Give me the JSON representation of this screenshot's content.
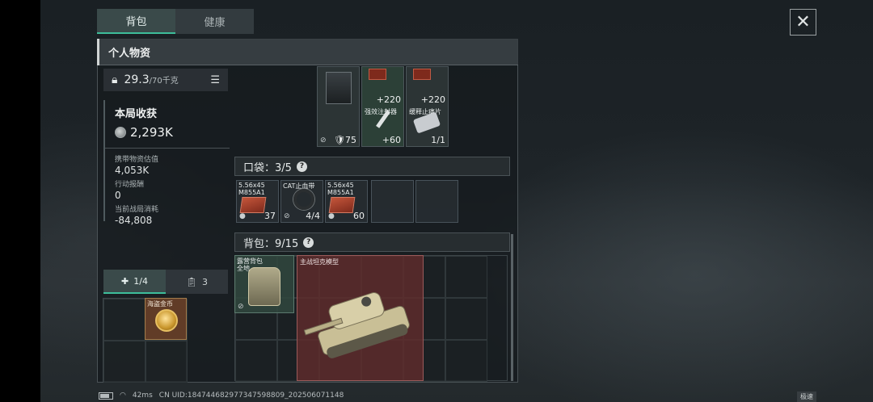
{
  "tabs": [
    {
      "label": "背包",
      "active": true
    },
    {
      "label": "健康",
      "active": false
    }
  ],
  "panel": {
    "title": "个人物资"
  },
  "weight": {
    "value": "29.3",
    "max": "/70千克"
  },
  "harvest": {
    "title": "本局收获",
    "total": "2,293K",
    "stats": [
      {
        "label": "携带物资估值",
        "value": "4,053K"
      },
      {
        "label": "行动报酬",
        "value": "0"
      },
      {
        "label": "当前战局消耗",
        "value": "-84,808"
      }
    ]
  },
  "side_tabs": [
    {
      "label": "1/4",
      "icon": "medkit-icon",
      "active": true
    },
    {
      "label": "3",
      "icon": "clipboard-icon",
      "active": false
    }
  ],
  "safe_box": {
    "item_label": "海盗金币"
  },
  "top_items": [
    {
      "name": "",
      "value": "75"
    },
    {
      "name": "强效注射器",
      "top_value": "+220",
      "value": "+60"
    },
    {
      "name": "缓释止痛片",
      "top_value": "+220",
      "value": "1/1"
    }
  ],
  "pocket": {
    "label": "口袋：",
    "count": "3/5",
    "items": [
      {
        "line1": "5.56x45",
        "line2": "M855A1",
        "value": "37"
      },
      {
        "line1": "CAT止血带",
        "line2": "",
        "value": "4/4"
      },
      {
        "line1": "5.56x45",
        "line2": "M855A1",
        "value": "60"
      }
    ]
  },
  "backpack": {
    "label": "背包：",
    "count": "9/15",
    "items": [
      {
        "line1": "露营背包",
        "line2": "全地..."
      },
      {
        "line1": "主战坦克模型"
      }
    ]
  },
  "status": {
    "ping": "42ms",
    "uid": "CN UID:18474468297734759880​9_202506071148",
    "speed_label": "极速"
  },
  "colors": {
    "accent": "#3dbd9a",
    "tank_bg": "#602c2c",
    "backpack_bg": "#30483e"
  }
}
